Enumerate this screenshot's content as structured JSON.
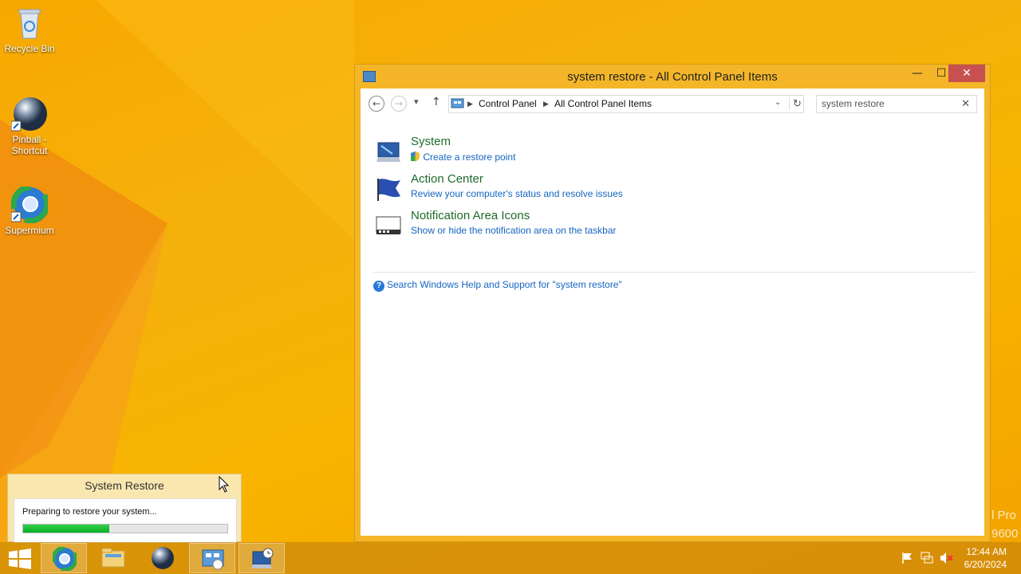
{
  "desktop": {
    "icons": [
      {
        "label": "Recycle Bin"
      },
      {
        "label": "Pinball - Shortcut"
      },
      {
        "label": "Supermium"
      }
    ],
    "watermark": {
      "line1": "l Pro",
      "line2": "9600"
    }
  },
  "window": {
    "title": "system restore - All Control Panel Items",
    "controls": {
      "minimize": "—",
      "maximize": "☐",
      "close": "✕"
    },
    "nav": {
      "back": "←",
      "forward": "→",
      "recent": "▾",
      "up": "↑",
      "refresh": "↻"
    },
    "breadcrumb": [
      "Control Panel",
      "All Control Panel Items"
    ],
    "search": {
      "value": "system restore",
      "clear": "✕"
    },
    "results": [
      {
        "title": "System",
        "link": "Create a restore point"
      },
      {
        "title": "Action Center",
        "link": "Review your computer's status and resolve issues"
      },
      {
        "title": "Notification Area Icons",
        "link": "Show or hide the notification area on the taskbar"
      }
    ],
    "help_link": "Search Windows Help and Support for \"system restore\""
  },
  "restore_popup": {
    "title": "System Restore",
    "status": "Preparing to restore your system...",
    "progress": 0.42
  },
  "taskbar": {
    "clock": {
      "time": "12:44 AM",
      "date": "6/20/2024"
    }
  }
}
